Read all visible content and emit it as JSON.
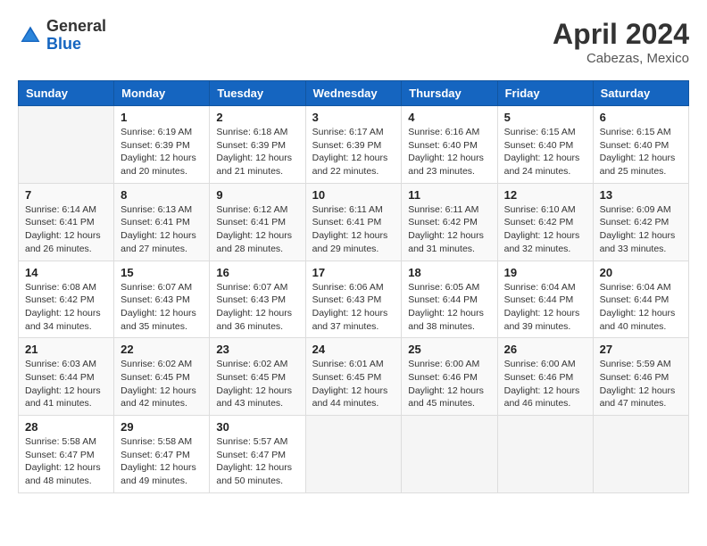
{
  "header": {
    "logo_general": "General",
    "logo_blue": "Blue",
    "month_year": "April 2024",
    "location": "Cabezas, Mexico"
  },
  "weekdays": [
    "Sunday",
    "Monday",
    "Tuesday",
    "Wednesday",
    "Thursday",
    "Friday",
    "Saturday"
  ],
  "weeks": [
    [
      {
        "day": "",
        "info": ""
      },
      {
        "day": "1",
        "info": "Sunrise: 6:19 AM\nSunset: 6:39 PM\nDaylight: 12 hours\nand 20 minutes."
      },
      {
        "day": "2",
        "info": "Sunrise: 6:18 AM\nSunset: 6:39 PM\nDaylight: 12 hours\nand 21 minutes."
      },
      {
        "day": "3",
        "info": "Sunrise: 6:17 AM\nSunset: 6:39 PM\nDaylight: 12 hours\nand 22 minutes."
      },
      {
        "day": "4",
        "info": "Sunrise: 6:16 AM\nSunset: 6:40 PM\nDaylight: 12 hours\nand 23 minutes."
      },
      {
        "day": "5",
        "info": "Sunrise: 6:15 AM\nSunset: 6:40 PM\nDaylight: 12 hours\nand 24 minutes."
      },
      {
        "day": "6",
        "info": "Sunrise: 6:15 AM\nSunset: 6:40 PM\nDaylight: 12 hours\nand 25 minutes."
      }
    ],
    [
      {
        "day": "7",
        "info": "Sunrise: 6:14 AM\nSunset: 6:41 PM\nDaylight: 12 hours\nand 26 minutes."
      },
      {
        "day": "8",
        "info": "Sunrise: 6:13 AM\nSunset: 6:41 PM\nDaylight: 12 hours\nand 27 minutes."
      },
      {
        "day": "9",
        "info": "Sunrise: 6:12 AM\nSunset: 6:41 PM\nDaylight: 12 hours\nand 28 minutes."
      },
      {
        "day": "10",
        "info": "Sunrise: 6:11 AM\nSunset: 6:41 PM\nDaylight: 12 hours\nand 29 minutes."
      },
      {
        "day": "11",
        "info": "Sunrise: 6:11 AM\nSunset: 6:42 PM\nDaylight: 12 hours\nand 31 minutes."
      },
      {
        "day": "12",
        "info": "Sunrise: 6:10 AM\nSunset: 6:42 PM\nDaylight: 12 hours\nand 32 minutes."
      },
      {
        "day": "13",
        "info": "Sunrise: 6:09 AM\nSunset: 6:42 PM\nDaylight: 12 hours\nand 33 minutes."
      }
    ],
    [
      {
        "day": "14",
        "info": "Sunrise: 6:08 AM\nSunset: 6:42 PM\nDaylight: 12 hours\nand 34 minutes."
      },
      {
        "day": "15",
        "info": "Sunrise: 6:07 AM\nSunset: 6:43 PM\nDaylight: 12 hours\nand 35 minutes."
      },
      {
        "day": "16",
        "info": "Sunrise: 6:07 AM\nSunset: 6:43 PM\nDaylight: 12 hours\nand 36 minutes."
      },
      {
        "day": "17",
        "info": "Sunrise: 6:06 AM\nSunset: 6:43 PM\nDaylight: 12 hours\nand 37 minutes."
      },
      {
        "day": "18",
        "info": "Sunrise: 6:05 AM\nSunset: 6:44 PM\nDaylight: 12 hours\nand 38 minutes."
      },
      {
        "day": "19",
        "info": "Sunrise: 6:04 AM\nSunset: 6:44 PM\nDaylight: 12 hours\nand 39 minutes."
      },
      {
        "day": "20",
        "info": "Sunrise: 6:04 AM\nSunset: 6:44 PM\nDaylight: 12 hours\nand 40 minutes."
      }
    ],
    [
      {
        "day": "21",
        "info": "Sunrise: 6:03 AM\nSunset: 6:44 PM\nDaylight: 12 hours\nand 41 minutes."
      },
      {
        "day": "22",
        "info": "Sunrise: 6:02 AM\nSunset: 6:45 PM\nDaylight: 12 hours\nand 42 minutes."
      },
      {
        "day": "23",
        "info": "Sunrise: 6:02 AM\nSunset: 6:45 PM\nDaylight: 12 hours\nand 43 minutes."
      },
      {
        "day": "24",
        "info": "Sunrise: 6:01 AM\nSunset: 6:45 PM\nDaylight: 12 hours\nand 44 minutes."
      },
      {
        "day": "25",
        "info": "Sunrise: 6:00 AM\nSunset: 6:46 PM\nDaylight: 12 hours\nand 45 minutes."
      },
      {
        "day": "26",
        "info": "Sunrise: 6:00 AM\nSunset: 6:46 PM\nDaylight: 12 hours\nand 46 minutes."
      },
      {
        "day": "27",
        "info": "Sunrise: 5:59 AM\nSunset: 6:46 PM\nDaylight: 12 hours\nand 47 minutes."
      }
    ],
    [
      {
        "day": "28",
        "info": "Sunrise: 5:58 AM\nSunset: 6:47 PM\nDaylight: 12 hours\nand 48 minutes."
      },
      {
        "day": "29",
        "info": "Sunrise: 5:58 AM\nSunset: 6:47 PM\nDaylight: 12 hours\nand 49 minutes."
      },
      {
        "day": "30",
        "info": "Sunrise: 5:57 AM\nSunset: 6:47 PM\nDaylight: 12 hours\nand 50 minutes."
      },
      {
        "day": "",
        "info": ""
      },
      {
        "day": "",
        "info": ""
      },
      {
        "day": "",
        "info": ""
      },
      {
        "day": "",
        "info": ""
      }
    ]
  ]
}
